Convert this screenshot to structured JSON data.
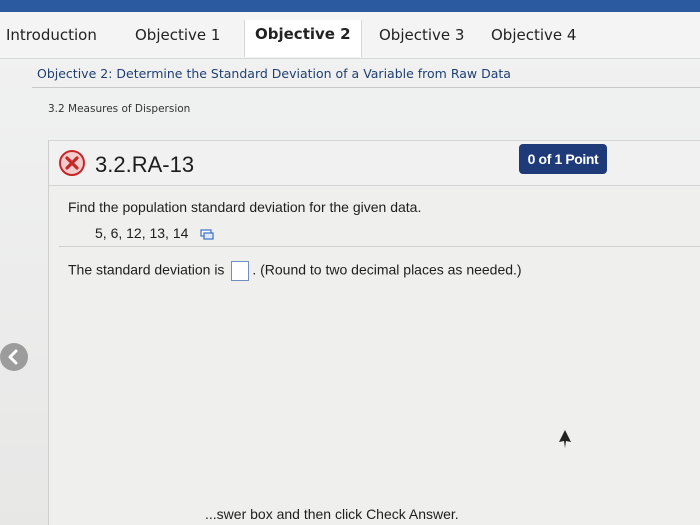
{
  "tabs": [
    {
      "label": "Introduction",
      "active": false
    },
    {
      "label": "Objective 1",
      "active": false
    },
    {
      "label": "Objective 2",
      "active": true
    },
    {
      "label": "Objective 3",
      "active": false
    },
    {
      "label": "Objective 4",
      "active": false
    }
  ],
  "objective": {
    "title": "Objective 2: Determine the Standard Deviation of a Variable from Raw Data"
  },
  "section": {
    "label": "3.2 Measures of Dispersion"
  },
  "question": {
    "status_icon": "incorrect-x-icon",
    "id": "3.2.RA-13",
    "points": "0 of 1 Point",
    "prompt": "Find the population standard deviation for the given data.",
    "data_values": "5, 6, 12, 13, 14",
    "copy_icon": "copy-data-icon",
    "answer_prefix": "The standard deviation is",
    "answer_value": "",
    "answer_suffix": ". (Round to two decimal places as needed.)"
  },
  "footer": {
    "hint": "...swer box and then click Check Answer."
  },
  "colors": {
    "accent_blue": "#1e3a78",
    "top_bar": "#2c5aa0",
    "incorrect_red": "#c62828"
  }
}
